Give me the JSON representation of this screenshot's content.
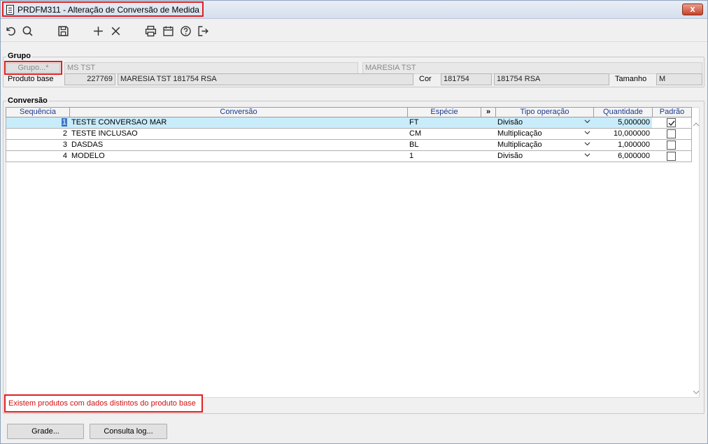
{
  "window": {
    "title": "PRDFM311 - Alteração de Conversão de Medida",
    "close_symbol": "x"
  },
  "toolbar": {
    "icons": [
      "undo-icon",
      "search-icon",
      "save-icon",
      "add-icon",
      "delete-icon",
      "print-icon",
      "calendar-icon",
      "help-icon",
      "exit-icon"
    ]
  },
  "grupo": {
    "label": "Grupo",
    "button_label": "Grupo...*",
    "field1": "MS TST",
    "field2": "MARESIA TST",
    "produto_base_label": "Produto base",
    "produto_code": "227769",
    "produto_desc": "MARESIA TST 181754 RSA",
    "cor_label": "Cor",
    "cor_code": "181754",
    "cor_desc": "181754 RSA",
    "tamanho_label": "Tamanho",
    "tamanho_value": "M"
  },
  "conversao": {
    "label": "Conversão",
    "columns": {
      "sequencia": "Sequência",
      "conversao": "Conversão",
      "especie": "Espécie",
      "expand": "»",
      "tipo_operacao": "Tipo operação",
      "quantidade": "Quantidade",
      "padrao": "Padrão"
    },
    "rows": [
      {
        "seq": "1",
        "conversao": "TESTE CONVERSAO MAR",
        "especie": "FT",
        "tipo": "Divisão",
        "quantidade": "5,000000",
        "padrao": true
      },
      {
        "seq": "2",
        "conversao": "TESTE INCLUSAO",
        "especie": "CM",
        "tipo": "Multiplicação",
        "quantidade": "10,000000",
        "padrao": false
      },
      {
        "seq": "3",
        "conversao": "DASDAS",
        "especie": "BL",
        "tipo": "Multiplicação",
        "quantidade": "1,000000",
        "padrao": false
      },
      {
        "seq": "4",
        "conversao": "MODELO",
        "especie": "1",
        "tipo": "Divisão",
        "quantidade": "6,000000",
        "padrao": false
      }
    ]
  },
  "status": {
    "message": "Existem produtos com dados distintos do produto base",
    "color": "#d01010"
  },
  "buttons": {
    "grade": "Grade...",
    "consulta_log": "Consulta log..."
  }
}
